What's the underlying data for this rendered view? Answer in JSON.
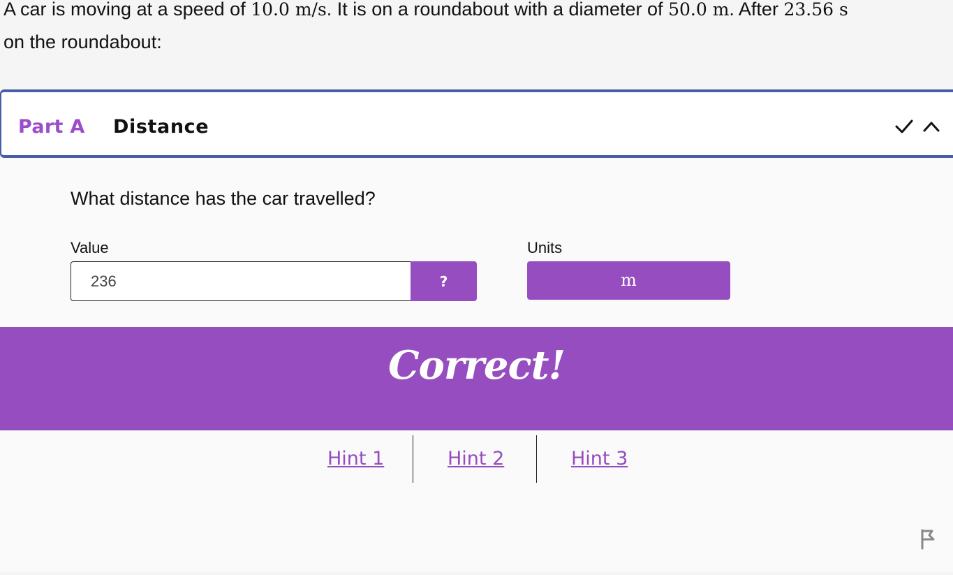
{
  "question": {
    "text_part1": "A car is moving at a speed of ",
    "speed_value": "10.0 m/s",
    "text_part2": ". It is on a roundabout with a diameter of ",
    "diameter_value": "50.0 m",
    "text_part3": ". After ",
    "time_value": "23.56 s",
    "text_part4": " on the roundabout:"
  },
  "part": {
    "label": "Part A",
    "title": "Distance",
    "check_icon": "check-icon",
    "collapse_icon": "chevron-up-icon",
    "prompt": "What distance has the car travelled?",
    "value_label": "Value",
    "value": "236",
    "help_label": "?",
    "units_label": "Units",
    "units_value": "m",
    "feedback": "Correct!",
    "hints": [
      "Hint 1",
      "Hint 2",
      "Hint 3"
    ],
    "report_icon": "flag-icon"
  },
  "colors": {
    "accent": "#954dbf",
    "border": "#4a5da8"
  }
}
